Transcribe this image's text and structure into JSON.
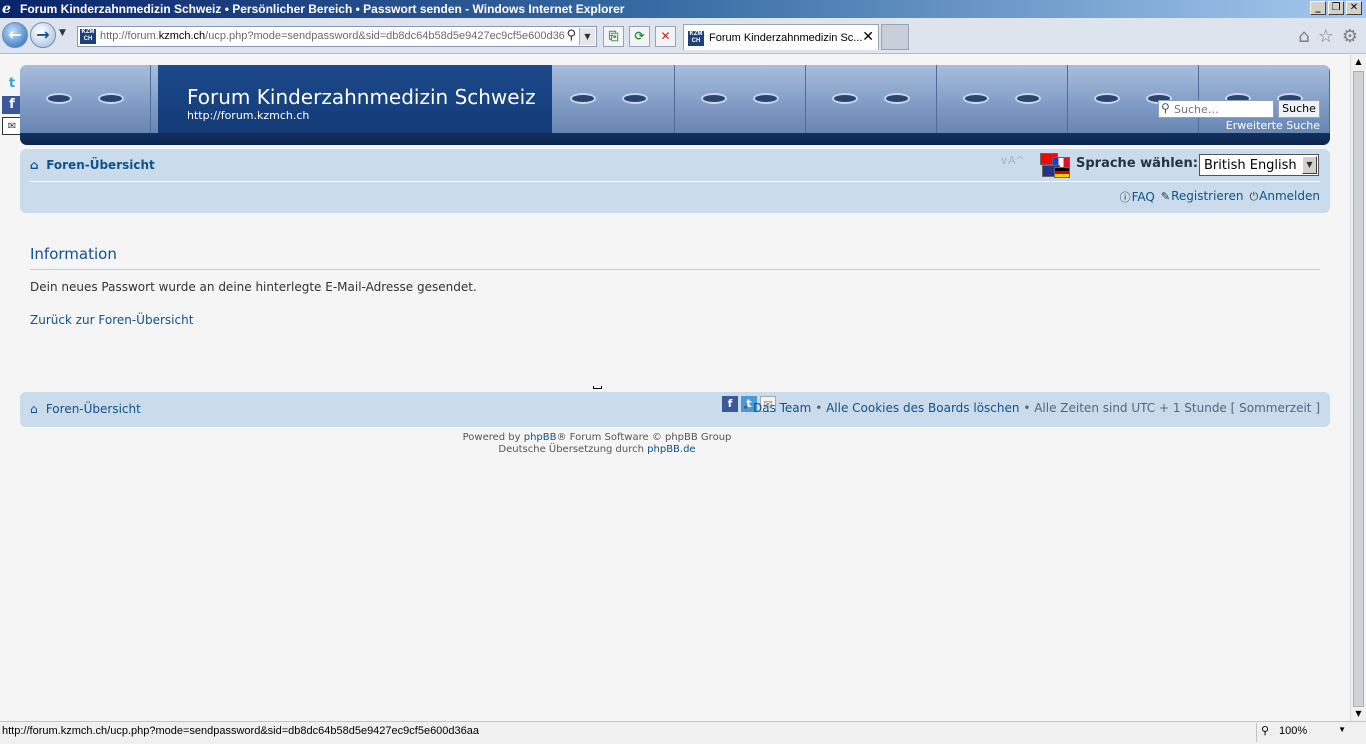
{
  "window": {
    "title": "Forum Kinderzahnmedizin Schweiz • Persönlicher Bereich • Passwort senden - Windows Internet Explorer",
    "app_logo_glyph": "e",
    "buttons": {
      "minimize": "_",
      "maximize": "❐",
      "close": "✕"
    }
  },
  "browser": {
    "favicon_text": "KZM CH",
    "url_prefix": "http://forum.",
    "url_domain": "kzmch.ch",
    "url_rest": "/ucp.php?mode=sendpassword&sid=db8dc64b58d5e9427ec9cf5e600d36",
    "tab_title": "Forum Kinderzahnmedizin Sc...",
    "tab_close": "✕",
    "status_url": "http://forum.kzmch.ch/ucp.php?mode=sendpassword&sid=db8dc64b58d5e9427ec9cf5e600d36aa",
    "zoom": "100%"
  },
  "header": {
    "site_title": "Forum Kinderzahnmedizin Schweiz",
    "site_url": "http://forum.kzmch.ch",
    "search_placeholder": "Suche…",
    "search_button": "Suche",
    "advanced_search": "Erweiterte Suche"
  },
  "navbar": {
    "breadcrumb": "Foren-Übersicht",
    "font_size_controls": "∨A^",
    "language_label": "Sprache wählen:",
    "language_selected": "British English",
    "links": {
      "faq": "FAQ",
      "register": "Registrieren",
      "login": "Anmelden"
    }
  },
  "content": {
    "heading": "Information",
    "message": "Dein neues Passwort wurde an deine hinterlegte E-Mail-Adresse gesendet.",
    "back_link": "Zurück zur Foren-Übersicht"
  },
  "footer": {
    "breadcrumb": "Foren-Übersicht",
    "sep": "•",
    "team": "Das Team",
    "delete_cookies": "Alle Cookies des Boards löschen",
    "timezone": "Alle Zeiten sind UTC + 1 Stunde [ Sommerzeit ]",
    "powered_pre": "Powered by ",
    "powered_link": "phpBB",
    "powered_post": "® Forum Software © phpBB Group",
    "translation_pre": "Deutsche Übersetzung durch ",
    "translation_link": "phpBB.de"
  },
  "icons": {
    "social_side": [
      "twitter-icon",
      "facebook-icon",
      "mail-icon"
    ],
    "footer_social": [
      "facebook-icon",
      "twitter-icon",
      "mail-icon"
    ]
  }
}
